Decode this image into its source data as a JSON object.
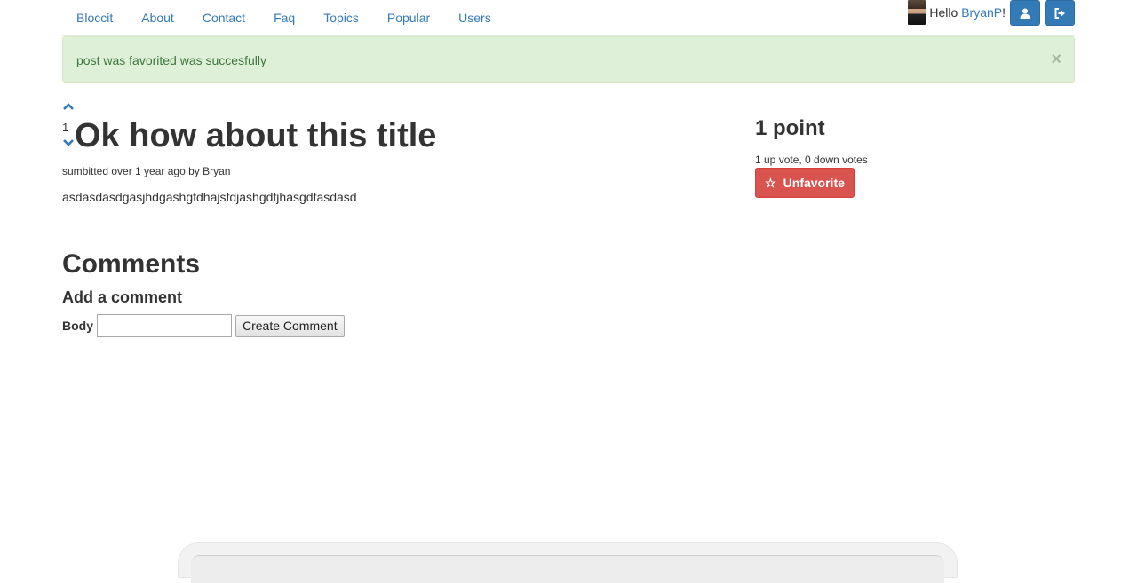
{
  "nav": {
    "links": [
      "Bloccit",
      "About",
      "Contact",
      "Faq",
      "Topics",
      "Popular",
      "Users"
    ],
    "hello_prefix": "Hello ",
    "username": "BryanP",
    "hello_suffix": "!",
    "icons": [
      "user-icon",
      "sign-out-icon"
    ]
  },
  "alert": {
    "message": "post was favorited was succesfully",
    "close": "×"
  },
  "post": {
    "vote_count": "1",
    "title": "Ok how about this title",
    "submitted": "sumbitted over 1 year ago by Bryan",
    "body": "asdasdasdgasjhdgashgfdhajsfdjashgdfjhasgdfasdasd"
  },
  "sidebar": {
    "points": "1 point",
    "votes_summary": "1 up vote, 0 down votes",
    "unfavorite_icon": "☆",
    "unfavorite_label": "Unfavorite"
  },
  "comments": {
    "heading": "Comments",
    "add_heading": "Add a comment",
    "body_label": "Body",
    "body_value": "",
    "submit_label": "Create Comment"
  },
  "colors": {
    "link": "#337ab7",
    "success_bg": "#dff0d8",
    "success_text": "#3c763d",
    "danger": "#d9534f"
  }
}
